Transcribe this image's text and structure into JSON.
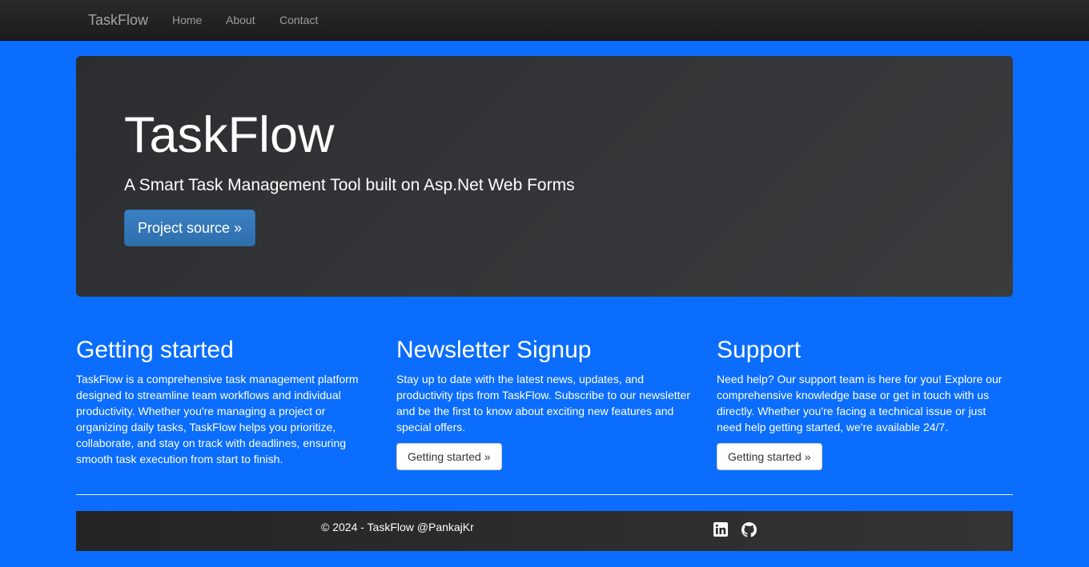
{
  "navbar": {
    "brand": "TaskFlow",
    "links": [
      "Home",
      "About",
      "Contact"
    ]
  },
  "hero": {
    "title": "TaskFlow",
    "lead": "A Smart Task Management Tool built on Asp.Net Web Forms",
    "button": "Project source »"
  },
  "columns": [
    {
      "title": "Getting started",
      "text": "TaskFlow is a comprehensive task management platform designed to streamline team workflows and individual productivity. Whether you're managing a project or organizing daily tasks, TaskFlow helps you prioritize, collaborate, and stay on track with deadlines, ensuring smooth task execution from start to finish."
    },
    {
      "title": "Newsletter Signup",
      "text": "Stay up to date with the latest news, updates, and productivity tips from TaskFlow. Subscribe to our newsletter and be the first to know about exciting new features and special offers.",
      "button": "Getting started »"
    },
    {
      "title": "Support",
      "text": "Need help? Our support team is here for you! Explore our comprehensive knowledge base or get in touch with us directly. Whether you're facing a technical issue or just need help getting started, we're available 24/7.",
      "button": "Getting started »"
    }
  ],
  "footer": {
    "copyright": "© 2024 - TaskFlow @PankajKr",
    "social": [
      "linkedin-icon",
      "github-icon"
    ]
  },
  "colors": {
    "page_background": "#0a6dfd",
    "navbar": "#222222",
    "hero": "#333538",
    "primary_button": "#337ab7"
  }
}
